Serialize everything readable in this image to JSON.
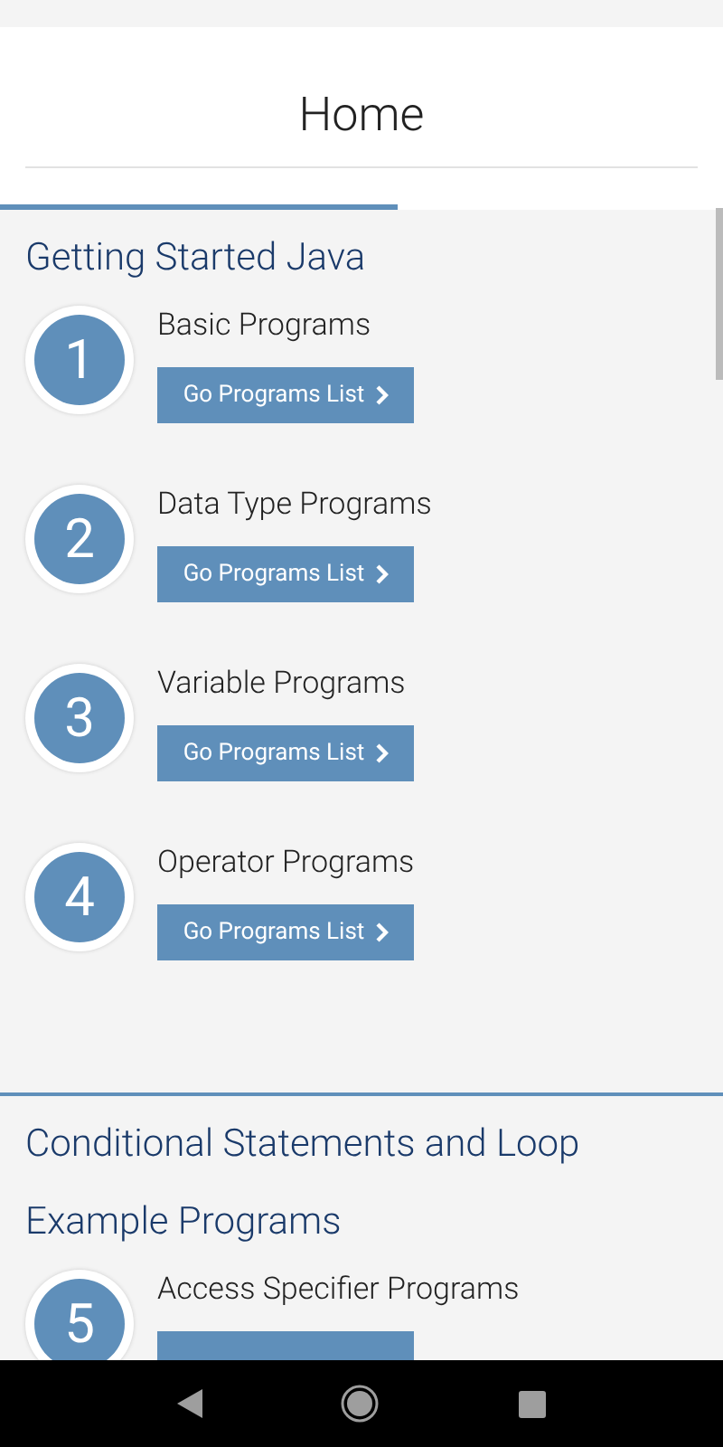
{
  "header": {
    "title": "Home"
  },
  "sections": [
    {
      "title": "Getting Started Java",
      "items": [
        {
          "number": "1",
          "title": "Basic Programs",
          "button": "Go Programs List"
        },
        {
          "number": "2",
          "title": "Data Type Programs",
          "button": "Go Programs List"
        },
        {
          "number": "3",
          "title": "Variable Programs",
          "button": "Go Programs List"
        },
        {
          "number": "4",
          "title": "Operator Programs",
          "button": "Go Programs List"
        }
      ]
    },
    {
      "title": "Conditional Statements and Loop Example Programs",
      "items": [
        {
          "number": "5",
          "title": "Access Specifier Programs"
        }
      ]
    }
  ]
}
